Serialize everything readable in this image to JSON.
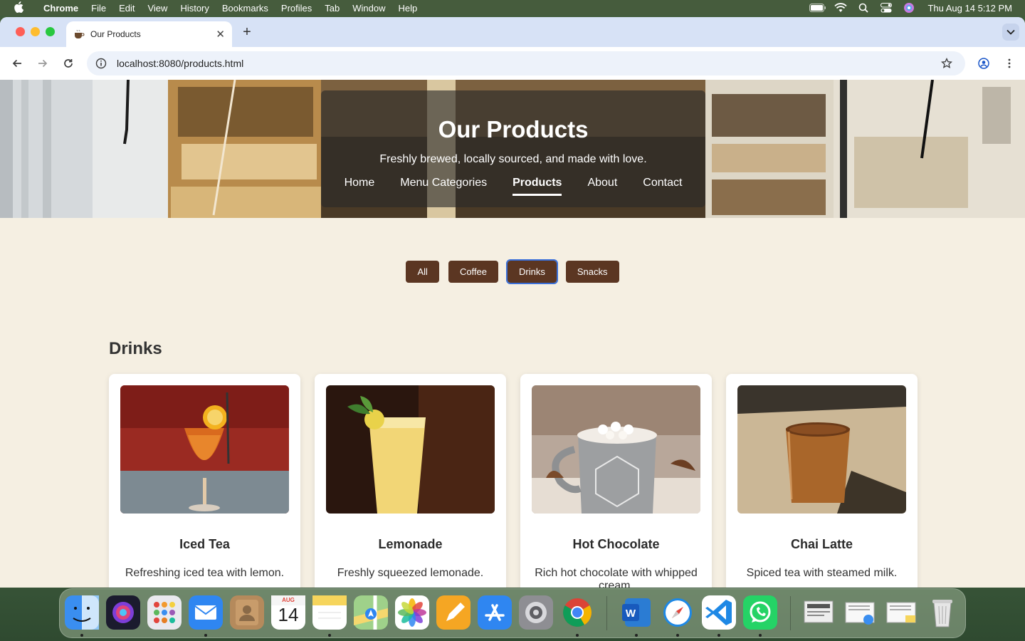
{
  "menubar": {
    "app": "Chrome",
    "items": [
      "File",
      "Edit",
      "View",
      "History",
      "Bookmarks",
      "Profiles",
      "Tab",
      "Window",
      "Help"
    ],
    "clock": "Thu Aug 14  5:12 PM"
  },
  "browser": {
    "tab_title": "Our Products",
    "url": "localhost:8080/products.html"
  },
  "hero": {
    "title": "Our Products",
    "subtitle": "Freshly brewed, locally sourced, and made with love.",
    "nav": [
      "Home",
      "Menu Categories",
      "Products",
      "About",
      "Contact"
    ],
    "active_nav": "Products"
  },
  "filters": {
    "buttons": [
      "All",
      "Coffee",
      "Drinks",
      "Snacks"
    ],
    "selected": "Drinks"
  },
  "section": {
    "title": "Drinks"
  },
  "products": [
    {
      "name": "Iced Tea",
      "description": "Refreshing iced tea with lemon.",
      "image": "iced-tea-photo"
    },
    {
      "name": "Lemonade",
      "description": "Freshly squeezed lemonade.",
      "image": "lemonade-photo"
    },
    {
      "name": "Hot Chocolate",
      "description": "Rich hot chocolate with whipped cream.",
      "image": "hot-chocolate-photo"
    },
    {
      "name": "Chai Latte",
      "description": "Spiced tea with steamed milk.",
      "image": "chai-latte-photo"
    }
  ],
  "dock": {
    "calendar_month": "AUG",
    "calendar_day": "14",
    "apps": [
      "finder",
      "siri",
      "launchpad",
      "mail",
      "contacts",
      "calendar",
      "notes",
      "maps",
      "photos",
      "pages",
      "app-store",
      "system-settings",
      "chrome",
      "word",
      "safari",
      "vscode",
      "whatsapp",
      "document",
      "finder-doc",
      "notes-doc",
      "trash"
    ]
  },
  "colors": {
    "button_brown": "#5b3622",
    "page_bg": "#f5efe2",
    "selected_outline": "#3a6fd8"
  }
}
